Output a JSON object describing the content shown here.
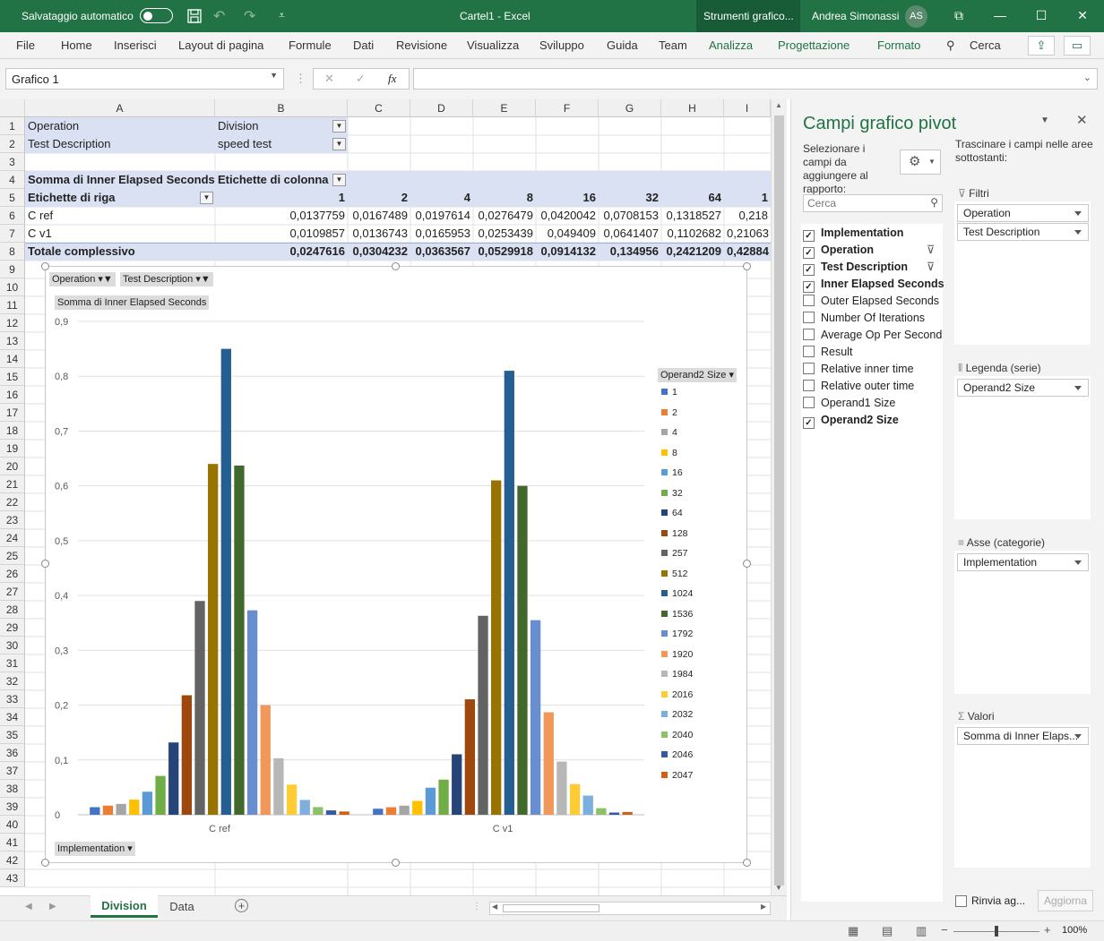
{
  "titlebar": {
    "autosave_label": "Salvataggio automatico",
    "doc_title": "Cartel1  -  Excel",
    "context_tab": "Strumenti grafico...",
    "user_name": "Andrea Simonassi",
    "user_initials": "AS"
  },
  "ribbon": {
    "tabs": [
      "File",
      "Home",
      "Inserisci",
      "Layout di pagina",
      "Formule",
      "Dati",
      "Revisione",
      "Visualizza",
      "Sviluppo",
      "Guida",
      "Team",
      "Analizza",
      "Progettazione",
      "Formato"
    ],
    "search_label": "Cerca"
  },
  "formula_bar": {
    "name_box": "Grafico 1",
    "fx": "fx",
    "formula": ""
  },
  "sheet": {
    "columns": [
      "A",
      "B",
      "C",
      "D",
      "E",
      "F",
      "G",
      "H",
      "I"
    ],
    "rows": [
      "1",
      "2",
      "3",
      "4",
      "5",
      "6",
      "7",
      "8",
      "9",
      "10",
      "11",
      "12",
      "13",
      "14",
      "15",
      "16",
      "17",
      "18",
      "19",
      "20",
      "21",
      "22",
      "23",
      "24",
      "25",
      "26",
      "27",
      "28",
      "29",
      "30",
      "31",
      "32",
      "33",
      "34",
      "35",
      "36",
      "37",
      "38",
      "39",
      "40",
      "41",
      "42",
      "43"
    ],
    "filter_rows": [
      {
        "label": "Operation",
        "value": "Division"
      },
      {
        "label": "Test Description",
        "value": "speed test"
      }
    ],
    "values_header": "Somma di Inner Elapsed Seconds",
    "col_labels_header": "Etichette di colonna",
    "row_labels_header": "Etichette di riga",
    "col_sizes": [
      "1",
      "2",
      "4",
      "8",
      "16",
      "32",
      "64",
      "1"
    ],
    "data_rows": [
      {
        "label": "C ref",
        "values": [
          "0,0137759",
          "0,0167489",
          "0,0197614",
          "0,0276479",
          "0,0420042",
          "0,0708153",
          "0,1318527",
          "0,218"
        ]
      },
      {
        "label": "C v1",
        "values": [
          "0,0109857",
          "0,0136743",
          "0,0165953",
          "0,0253439",
          "0,049409",
          "0,0641407",
          "0,1102682",
          "0,21063"
        ]
      }
    ],
    "total_row": {
      "label": "Totale complessivo",
      "values": [
        "0,0247616",
        "0,0304232",
        "0,0363567",
        "0,0529918",
        "0,0914132",
        "0,134956",
        "0,2421209",
        "0,42884"
      ]
    }
  },
  "chart_data": {
    "type": "bar",
    "title": "",
    "value_field_button": "Somma  di Inner Elapsed Seconds",
    "filter_buttons": [
      "Operation",
      "Test Description"
    ],
    "axis_field_button": "Implementation",
    "legend_title": "Operand2 Size",
    "categories": [
      "C ref",
      "C v1"
    ],
    "ylim": [
      0,
      0.9
    ],
    "yticks": [
      "0",
      "0,1",
      "0,2",
      "0,3",
      "0,4",
      "0,5",
      "0,6",
      "0,7",
      "0,8",
      "0,9"
    ],
    "grid": true,
    "legend_position": "right",
    "series": [
      {
        "name": "1",
        "color": "#4472c4",
        "values": [
          0.0138,
          0.011
        ]
      },
      {
        "name": "2",
        "color": "#ed7d31",
        "values": [
          0.0167,
          0.0137
        ]
      },
      {
        "name": "4",
        "color": "#a5a5a5",
        "values": [
          0.0198,
          0.0166
        ]
      },
      {
        "name": "8",
        "color": "#ffc000",
        "values": [
          0.0276,
          0.0253
        ]
      },
      {
        "name": "16",
        "color": "#5b9bd5",
        "values": [
          0.042,
          0.0494
        ]
      },
      {
        "name": "32",
        "color": "#70ad47",
        "values": [
          0.0708,
          0.0641
        ]
      },
      {
        "name": "64",
        "color": "#264478",
        "values": [
          0.1319,
          0.1103
        ]
      },
      {
        "name": "128",
        "color": "#9e480e",
        "values": [
          0.218,
          0.2106
        ]
      },
      {
        "name": "257",
        "color": "#636363",
        "values": [
          0.39,
          0.363
        ]
      },
      {
        "name": "512",
        "color": "#997300",
        "values": [
          0.64,
          0.61
        ]
      },
      {
        "name": "1024",
        "color": "#255e91",
        "values": [
          0.85,
          0.81
        ]
      },
      {
        "name": "1536",
        "color": "#43682b",
        "values": [
          0.637,
          0.6
        ]
      },
      {
        "name": "1792",
        "color": "#698ed0",
        "values": [
          0.373,
          0.355
        ]
      },
      {
        "name": "1920",
        "color": "#f1975a",
        "values": [
          0.2,
          0.187
        ]
      },
      {
        "name": "1984",
        "color": "#b7b7b7",
        "values": [
          0.103,
          0.097
        ]
      },
      {
        "name": "2016",
        "color": "#ffcd33",
        "values": [
          0.055,
          0.056
        ]
      },
      {
        "name": "2032",
        "color": "#7cafdd",
        "values": [
          0.027,
          0.035
        ]
      },
      {
        "name": "2040",
        "color": "#8cc168",
        "values": [
          0.014,
          0.012
        ]
      },
      {
        "name": "2046",
        "color": "#335aa1",
        "values": [
          0.008,
          0.004
        ]
      },
      {
        "name": "2047",
        "color": "#d26012",
        "values": [
          0.006,
          0.005
        ]
      }
    ]
  },
  "sheet_tabs": {
    "active": "Division",
    "other": "Data"
  },
  "status": {
    "zoom": "100%"
  },
  "pivot_panel": {
    "title": "Campi grafico pivot",
    "subtitle": "Selezionare i campi da aggiungere al rapporto:",
    "drag_hint": "Trascinare i campi nelle aree sottostanti:",
    "search_placeholder": "Cerca",
    "fields": [
      {
        "name": "Implementation",
        "checked": true
      },
      {
        "name": "Operation",
        "checked": true,
        "filtered": true
      },
      {
        "name": "Test Description",
        "checked": true,
        "filtered": true
      },
      {
        "name": "Inner Elapsed Seconds",
        "checked": true
      },
      {
        "name": "Outer Elapsed Seconds",
        "checked": false
      },
      {
        "name": "Number Of Iterations",
        "checked": false
      },
      {
        "name": "Average Op Per Second",
        "checked": false
      },
      {
        "name": "Result",
        "checked": false
      },
      {
        "name": "Relative inner time",
        "checked": false
      },
      {
        "name": "Relative outer time",
        "checked": false
      },
      {
        "name": "Operand1 Size",
        "checked": false
      },
      {
        "name": "Operand2 Size",
        "checked": true
      }
    ],
    "areas": {
      "filters": {
        "label": "Filtri",
        "items": [
          "Operation",
          "Test Description"
        ]
      },
      "legend": {
        "label": "Legenda (serie)",
        "items": [
          "Operand2 Size"
        ]
      },
      "axis": {
        "label": "Asse (categorie)",
        "items": [
          "Implementation"
        ]
      },
      "values": {
        "label": "Valori",
        "items": [
          "Somma di Inner Elaps..."
        ]
      }
    },
    "defer_label": "Rinvia ag...",
    "update_label": "Aggiorna"
  }
}
